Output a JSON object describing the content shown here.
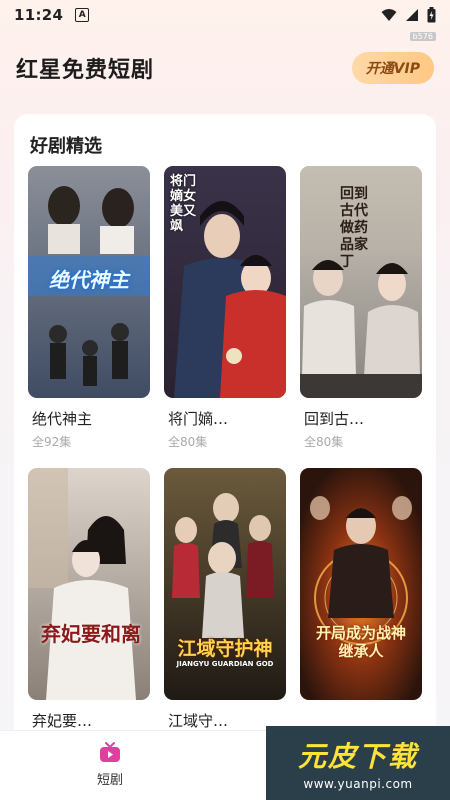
{
  "status_bar": {
    "time": "11:24",
    "notif_letter": "A"
  },
  "version_tag": "b576",
  "header": {
    "title": "红星免费短剧",
    "vip_label": "开通VIP"
  },
  "section": {
    "title": "好剧精选"
  },
  "dramas": [
    {
      "name": "绝代神主",
      "episodes": "全92集",
      "poster_text": "绝代神主",
      "colors": [
        "#8b8f98",
        "#3f4c63"
      ]
    },
    {
      "name": "将门嫡…",
      "episodes": "全80集",
      "poster_text": "将门嫡女美又飒",
      "colors": [
        "#3a3248",
        "#b43a3a"
      ]
    },
    {
      "name": "回到古…",
      "episodes": "全80集",
      "poster_text": "回到古代做药品家丁",
      "colors": [
        "#c9c3b8",
        "#7d7a75"
      ]
    },
    {
      "name": "弃妃要…",
      "episodes": "",
      "poster_text": "弃妃要和离",
      "colors": [
        "#d8cfc4",
        "#6a6059"
      ]
    },
    {
      "name": "江域守…",
      "episodes": "",
      "poster_text": "江域守护神",
      "subtitle": "JIANGYU GUARDIAN GOD",
      "colors": [
        "#5a4b32",
        "#2a241c"
      ]
    },
    {
      "name": "",
      "episodes": "",
      "poster_text": "开局成为战神继承人",
      "colors": [
        "#3a1f12",
        "#b3521c"
      ]
    }
  ],
  "bottom_nav": {
    "items": [
      {
        "label": "短剧",
        "icon": "tv-icon",
        "color": "#e03fa0"
      }
    ]
  },
  "watermark": {
    "main": "元皮下载",
    "sub": "www.yuanpi.com"
  }
}
